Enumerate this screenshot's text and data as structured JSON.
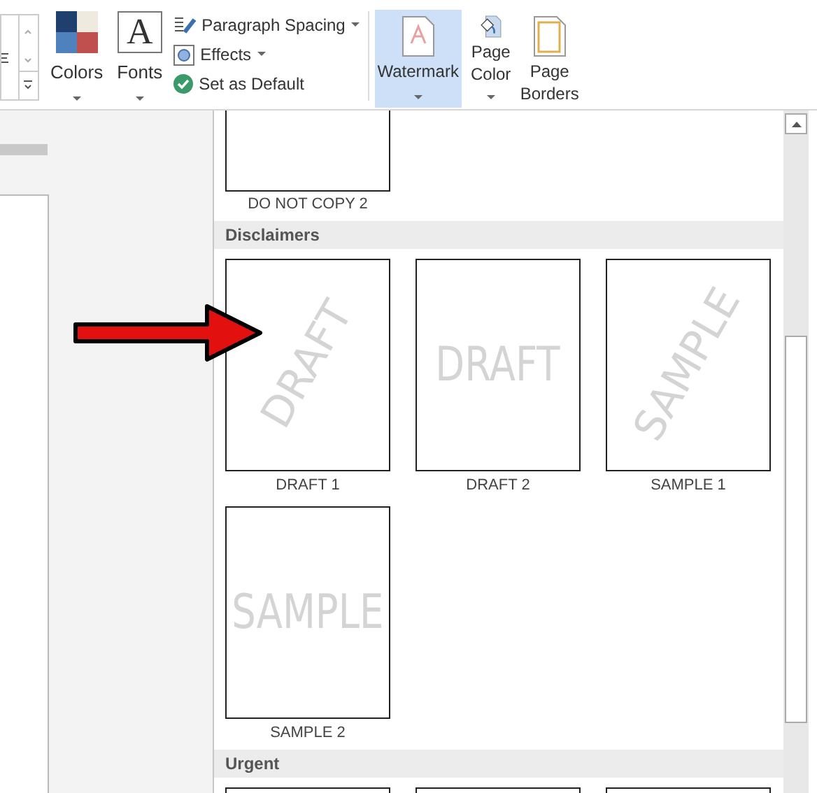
{
  "ribbon": {
    "large_buttons": [
      {
        "label": "Colors",
        "kind": "colors",
        "dropdown": true
      },
      {
        "label": "Fonts",
        "kind": "fonts",
        "icon_text": "A",
        "dropdown": true
      }
    ],
    "small_buttons": [
      {
        "label": "Paragraph Spacing",
        "kind": "spacing",
        "dropdown": true
      },
      {
        "label": "Effects",
        "kind": "effects",
        "dropdown": true
      },
      {
        "label": "Set as Default",
        "kind": "default",
        "dropdown": false
      }
    ],
    "page_buttons": [
      {
        "label": "Watermark",
        "kind": "watermark",
        "selected": true,
        "dropdown": true
      },
      {
        "label": "Page Color",
        "kind": "color",
        "selected": false,
        "dropdown": true
      },
      {
        "label": "Page Borders",
        "kind": "borders",
        "selected": false,
        "dropdown": false
      }
    ]
  },
  "gallery": {
    "sections": [
      {
        "items": [
          {
            "label": "DO NOT COPY 2",
            "kind": "cut_top"
          }
        ]
      },
      {
        "title": "Disclaimers",
        "items": [
          {
            "label": "DRAFT 1",
            "kind": "full",
            "watermark": "DRAFT",
            "diagonal": true
          },
          {
            "label": "DRAFT 2",
            "kind": "full",
            "watermark": "DRAFT",
            "diagonal": false
          },
          {
            "label": "SAMPLE 1",
            "kind": "full",
            "watermark": "SAMPLE",
            "diagonal": true
          },
          {
            "label": "SAMPLE 2",
            "kind": "full",
            "watermark": "SAMPLE",
            "diagonal": false
          }
        ]
      },
      {
        "title": "Urgent",
        "items": [
          {
            "kind": "cut_bottom"
          },
          {
            "kind": "cut_bottom"
          },
          {
            "kind": "cut_bottom"
          }
        ]
      }
    ]
  }
}
